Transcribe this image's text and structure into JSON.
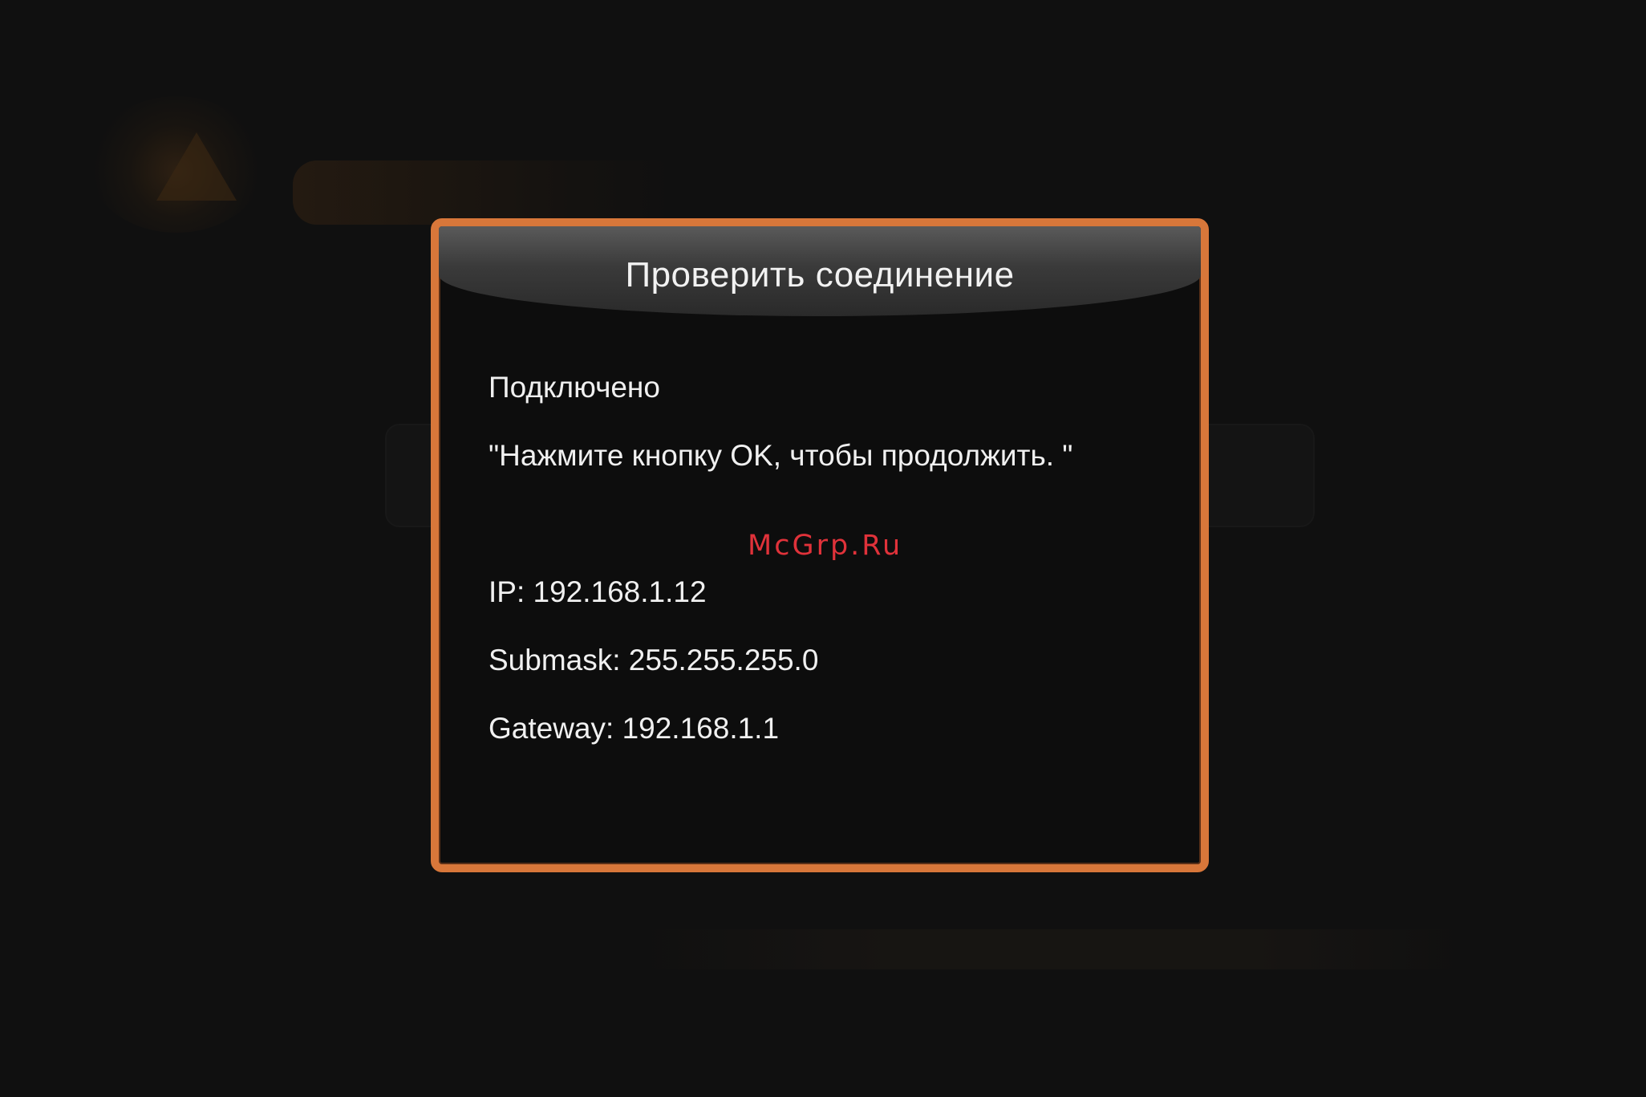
{
  "dialog": {
    "title": "Проверить соединение",
    "status": "Подключено",
    "prompt": "\"Нажмите кнопку OK, чтобы продолжить. \"",
    "network": {
      "ip": "IP: 192.168.1.12",
      "submask": "Submask: 255.255.255.0",
      "gateway": "Gateway: 192.168.1.1"
    }
  },
  "watermark": "McGrp.Ru",
  "colors": {
    "accent_border": "#d8773a",
    "background": "#101010",
    "watermark": "#e0323a"
  }
}
